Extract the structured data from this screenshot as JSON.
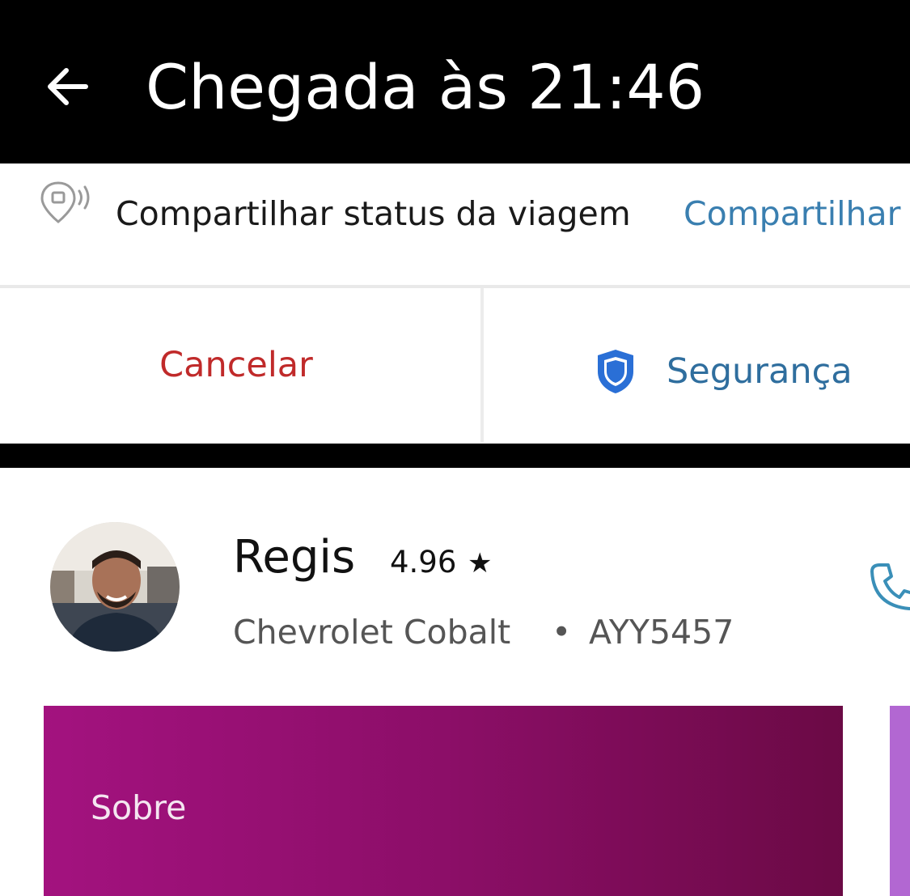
{
  "header": {
    "title": "Chegada às 21:46",
    "back_icon": "arrow-left-icon"
  },
  "share": {
    "icon": "location-pin-broadcast-icon",
    "text": "Compartilhar status da viagem",
    "link": "Compartilhar"
  },
  "actions": {
    "cancel_label": "Cancelar",
    "safety_label": "Segurança",
    "safety_icon": "shield-icon"
  },
  "driver": {
    "name": "Regis",
    "rating": "4.96",
    "star": "★",
    "car_model": "Chevrolet Cobalt",
    "separator": "•",
    "plate": "AYY5457",
    "phone_icon": "phone-icon"
  },
  "cards": {
    "about_label": "Sobre"
  },
  "colors": {
    "header_bg": "#000000",
    "link": "#3a7fb0",
    "cancel": "#c02a2a",
    "safety_text": "#2f6e9e",
    "shield": "#2a6fd6",
    "card_gradient_start": "#a3127f",
    "card_gradient_end": "#6b0a45",
    "next_card": "#b267d2"
  }
}
